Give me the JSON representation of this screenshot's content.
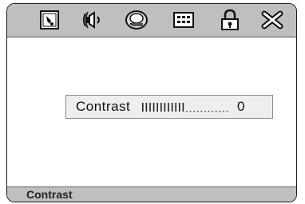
{
  "toolbar": {
    "icons": [
      "system-setup-icon",
      "audio-setup-icon",
      "video-setup-icon",
      "display-setup-icon",
      "lock-icon",
      "exit-icon"
    ]
  },
  "setting": {
    "label": "Contrast",
    "value": "0",
    "level_fraction": 0.5
  },
  "footer": {
    "title": "Contrast"
  }
}
